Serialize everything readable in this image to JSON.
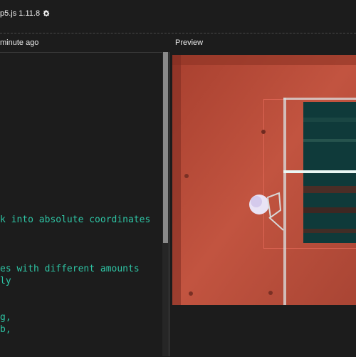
{
  "header": {
    "version": "p5.js 1.11.8",
    "settings_icon": "gear-icon"
  },
  "editor": {
    "saved_status": "minute ago",
    "lines": [
      "k into absolute coordinates",
      "es with different amounts",
      "ly",
      "g,",
      "b,"
    ]
  },
  "preview": {
    "label": "Preview"
  },
  "colors": {
    "background": "#1c1c1c",
    "code": "#2ec4a4",
    "canvas_red": "#b84a3a",
    "canvas_teal": "#0f3a3a"
  }
}
